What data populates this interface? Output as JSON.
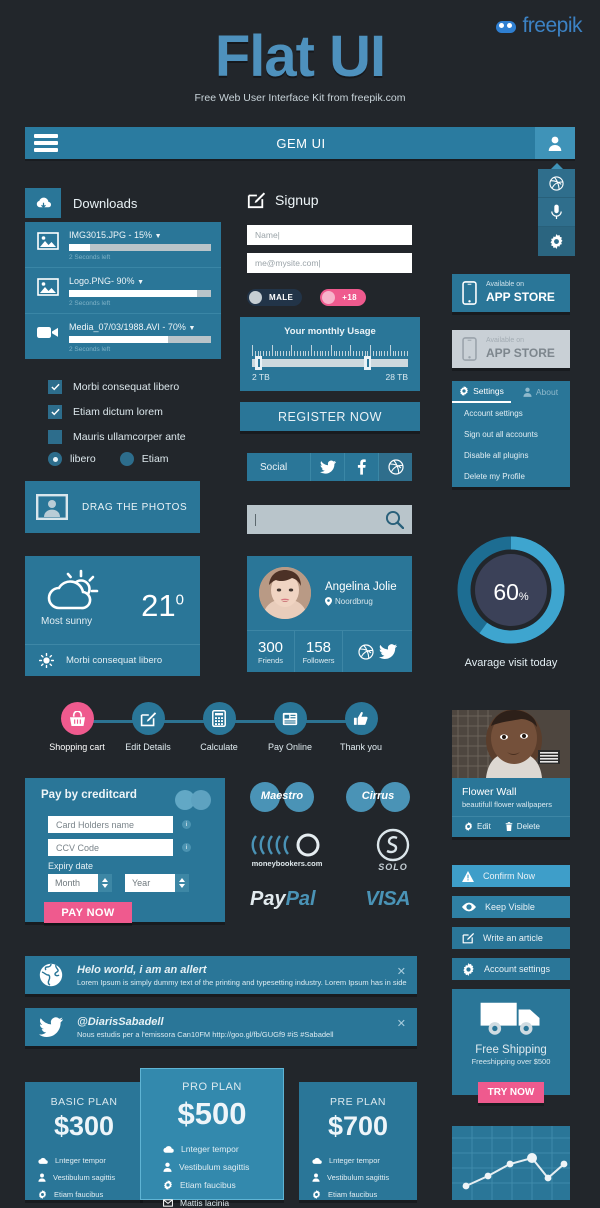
{
  "brand": {
    "name": "freepik",
    "icon": "freepik-logo-icon"
  },
  "hero": {
    "title": "Flat UI",
    "subtitle": "Free Web User Interface Kit from freepik.com"
  },
  "topbar": {
    "title": "GEM UI",
    "menu_icon": "hamburger-icon",
    "user_icon": "user-icon"
  },
  "rail": {
    "items": [
      {
        "icon": "dribbble-icon"
      },
      {
        "icon": "microphone-icon"
      },
      {
        "icon": "gear-icon"
      }
    ]
  },
  "downloads": {
    "title": "Downloads",
    "icon": "cloud-download-icon",
    "items": [
      {
        "name": "IMG3015.JPG - 15%",
        "percent": 15,
        "eta": "2 Seconds left",
        "icon": "image-icon"
      },
      {
        "name": "Logo.PNG- 90%",
        "percent": 90,
        "eta": "2 Seconds left",
        "icon": "image-icon"
      },
      {
        "name": "Media_07/03/1988.AVI - 70%",
        "percent": 70,
        "eta": "2 Seconds left",
        "icon": "video-icon"
      }
    ]
  },
  "checkboxes": [
    {
      "label": "Morbi consequat libero",
      "checked": true
    },
    {
      "label": "Etiam dictum lorem",
      "checked": true
    },
    {
      "label": "Mauris ullamcorper ante",
      "checked": false
    }
  ],
  "radios": [
    {
      "label": "libero",
      "selected": true
    },
    {
      "label": "Etiam",
      "selected": false
    }
  ],
  "drag": {
    "label": "DRAG  THE PHOTOS",
    "icon": "photo-portrait-icon"
  },
  "weather": {
    "condition": "Most sunny",
    "temperature": "21",
    "degree_symbol": "0",
    "footer": "Morbi consequat libero",
    "icon": "sun-cloud-icon",
    "footer_icon": "sun-icon"
  },
  "signup": {
    "title": "Signup",
    "icon": "compose-icon",
    "name_value": "Name|",
    "email_value": "me@mysite.com|",
    "pill_male": "MALE",
    "pill_age": "+18",
    "register_label": "REGISTER NOW"
  },
  "usage": {
    "title": "Your monthly Usage",
    "min_label": "2 TB",
    "max_label": "28 TB",
    "min_percent": 2,
    "max_percent": 72
  },
  "social": {
    "label": "Social",
    "icons": [
      "twitter-icon",
      "facebook-icon",
      "dribbble-icon"
    ]
  },
  "search": {
    "value": "",
    "placeholder": "",
    "icon": "magnifier-icon"
  },
  "profile": {
    "name": "Angelina Jolie",
    "location": "Noordbrug",
    "location_icon": "map-pin-icon",
    "friends_count": "300",
    "friends_label": "Friends",
    "followers_count": "158",
    "followers_label": "Followers",
    "icons": [
      "dribbble-icon",
      "twitter-icon"
    ]
  },
  "appstore": [
    {
      "small": "Available on",
      "big": "APP STORE",
      "icon": "phone-icon",
      "state": "active"
    },
    {
      "small": "Available on",
      "big": "APP STORE",
      "icon": "phone-icon",
      "state": "disabled"
    }
  ],
  "settings": {
    "tabs": [
      {
        "label": "Settings",
        "icon": "gear-icon",
        "active": true
      },
      {
        "label": "About",
        "icon": "user-icon",
        "active": false
      }
    ],
    "items": [
      "Account settings",
      "Sign out all accounts",
      "Disable all plugins",
      "Delete my Profile"
    ]
  },
  "donut": {
    "value": "60",
    "unit": "%",
    "percent": 60,
    "caption": "Avarage visit today"
  },
  "stepper": [
    {
      "label": "Shopping cart",
      "icon": "basket-icon",
      "active": true
    },
    {
      "label": "Edit Details",
      "icon": "compose-icon",
      "active": false
    },
    {
      "label": "Calculate",
      "icon": "calculator-icon",
      "active": false
    },
    {
      "label": "Pay Online",
      "icon": "card-reader-icon",
      "active": false
    },
    {
      "label": "Thank you",
      "icon": "thumbs-up-icon",
      "active": false
    }
  ],
  "creditcard": {
    "title": "Pay by creditcard",
    "card_logo_icon": "mastercard-icon",
    "holder_placeholder": "Card Holders name",
    "ccv_placeholder": "CCV Code",
    "info_icon": "info-icon",
    "expiry_label": "Expiry date",
    "month_value": "Month",
    "year_value": "Year",
    "pay_label": "PAY NOW"
  },
  "paylogos": [
    {
      "name": "Maestro",
      "icon": "maestro-icon"
    },
    {
      "name": "Cirrus",
      "icon": "cirrus-icon"
    },
    {
      "name": "moneybookers.com",
      "icon": "moneybookers-icon"
    },
    {
      "name": "SOLO",
      "icon": "solo-icon"
    },
    {
      "name": "PayPal",
      "icon": "paypal-icon"
    },
    {
      "name": "VISA",
      "icon": "visa-icon"
    }
  ],
  "paypal": {
    "part1": "Pay",
    "part2": "Pal"
  },
  "media_card": {
    "title": "Flower Wall",
    "subtitle": "beautifull flower wallpapers",
    "edit_label": "Edit",
    "edit_icon": "gear-icon",
    "delete_label": "Delete",
    "delete_icon": "trash-icon"
  },
  "action_buttons": [
    {
      "label": "Confirm Now",
      "icon": "warning-icon"
    },
    {
      "label": "Keep Visible",
      "icon": "eye-icon"
    },
    {
      "label": "Write an article",
      "icon": "compose-icon"
    },
    {
      "label": "Account settings",
      "icon": "gear-icon"
    }
  ],
  "shipping": {
    "icon": "truck-icon",
    "title": "Free Shipping",
    "subtitle": "Freeshipping over $500",
    "cta": "TRY NOW"
  },
  "alerts": [
    {
      "title": "Helo world, i am an allert",
      "body": "Lorem Ipsum is simply dummy text of the printing and typesetting industry. Lorem Ipsum has in side",
      "icon": "globe-icon",
      "close_icon": "close-icon"
    },
    {
      "title": "@DiarisSabadell",
      "body": "Nous estudis per a l'emissora Can10FM http://goo.gl/fb/GUGf9  #iS #Sabadell",
      "icon": "twitter-icon",
      "close_icon": "close-icon"
    }
  ],
  "plans": [
    {
      "name": "BASIC PLAN",
      "price": "$300",
      "features": [
        {
          "label": "Lnteger tempor",
          "icon": "cloud-icon"
        },
        {
          "label": "Vestibulum sagittis",
          "icon": "user-icon"
        },
        {
          "label": "Etiam faucibus",
          "icon": "gear-icon"
        }
      ]
    },
    {
      "name": "PRO PLAN",
      "price": "$500",
      "featured": true,
      "features": [
        {
          "label": "Lnteger tempor",
          "icon": "cloud-icon"
        },
        {
          "label": "Vestibulum sagittis",
          "icon": "user-icon"
        },
        {
          "label": "Etiam faucibus",
          "icon": "gear-icon"
        },
        {
          "label": "Mattis lacinia",
          "icon": "mail-icon"
        }
      ]
    },
    {
      "name": "PRE PLAN",
      "price": "$700",
      "features": [
        {
          "label": "Lnteger tempor",
          "icon": "cloud-icon"
        },
        {
          "label": "Vestibulum sagittis",
          "icon": "user-icon"
        },
        {
          "label": "Etiam faucibus",
          "icon": "gear-icon"
        }
      ]
    }
  ],
  "chart_data": {
    "type": "line",
    "title": "",
    "x": [
      0,
      1,
      2,
      3,
      4,
      5,
      6
    ],
    "values": [
      8,
      22,
      46,
      58,
      24,
      44
    ],
    "ylim": [
      0,
      70
    ],
    "grid": true
  },
  "colors": {
    "background": "#22262b",
    "panel": "#2a7698",
    "accent": "#3e9ec9",
    "pink": "#ef5a8e",
    "light": "#c9d0d6"
  }
}
